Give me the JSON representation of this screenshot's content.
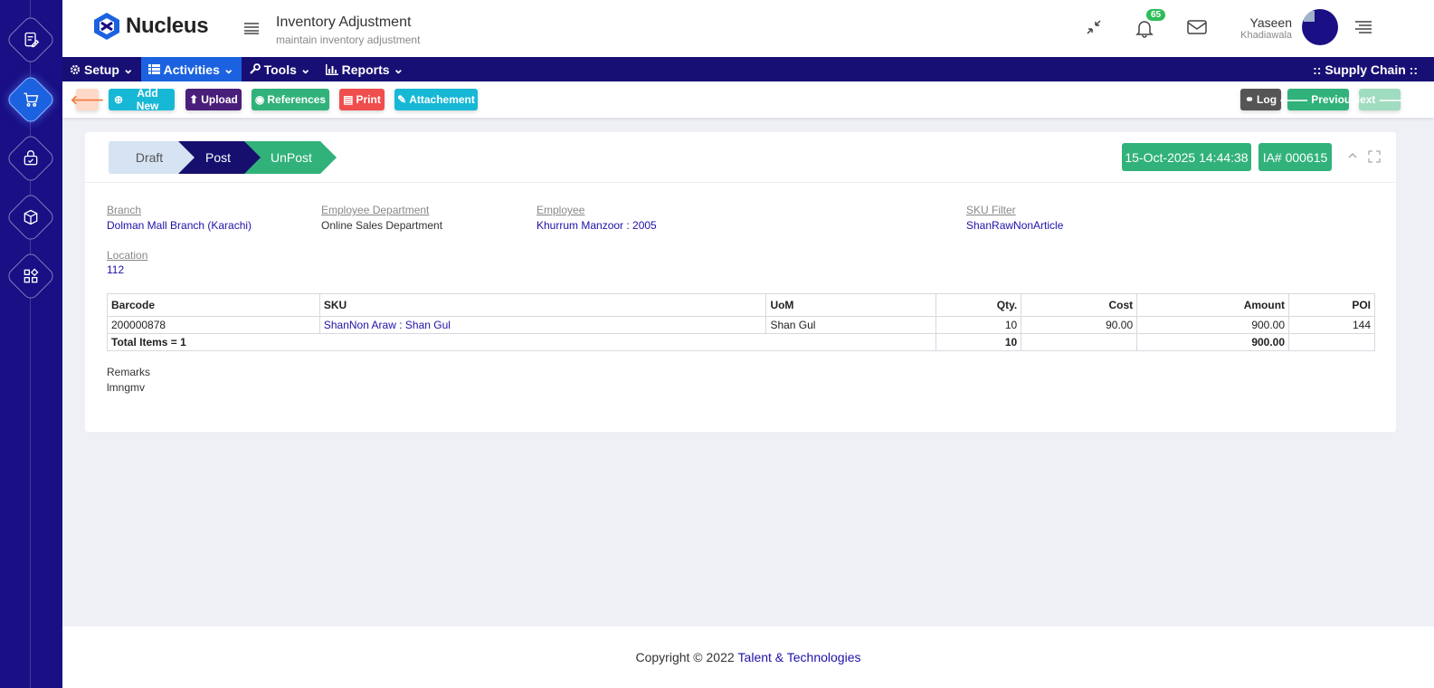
{
  "app": {
    "logo_text": "Nucleus",
    "page_title": "Inventory Adjustment",
    "page_subtitle": "maintain inventory adjustment"
  },
  "header": {
    "notification_count": "65",
    "user_name": "Yaseen",
    "user_surname": "Khadiawala"
  },
  "nav": {
    "items": [
      {
        "label": "Setup"
      },
      {
        "label": "Activities"
      },
      {
        "label": "Tools"
      },
      {
        "label": "Reports"
      }
    ],
    "module": ":: Supply Chain ::"
  },
  "toolbar": {
    "add_new": "Add New",
    "upload": "Upload",
    "references": "References",
    "print": "Print",
    "attachment": "Attachement",
    "log": "Log",
    "previous": "Previous",
    "next": "Next"
  },
  "workflow": {
    "steps": [
      "Draft",
      "Post",
      "UnPost"
    ],
    "datetime": "15-Oct-2025 14:44:38",
    "doc_no": "IA# 000615"
  },
  "form": {
    "branch_label": "Branch",
    "branch_value": "Dolman Mall Branch (Karachi)",
    "dept_label": "Employee Department",
    "dept_value": "Online Sales Department",
    "employee_label": "Employee",
    "employee_value": "Khurrum Manzoor : 2005",
    "sku_filter_label": "SKU Filter",
    "sku_filter_value": "ShanRawNonArticle",
    "location_label": "Location",
    "location_value": "112",
    "remarks_label": "Remarks",
    "remarks_value": "lmngmv"
  },
  "table": {
    "headers": [
      "Barcode",
      "SKU",
      "UoM",
      "Qty.",
      "Cost",
      "Amount",
      "POI"
    ],
    "rows": [
      {
        "barcode": "200000878",
        "sku": "ShanNon Araw : Shan Gul",
        "uom": "Shan Gul",
        "qty": "10",
        "cost": "90.00",
        "amount": "900.00",
        "poi": "144"
      }
    ],
    "total_label": "Total Items = 1",
    "total_qty": "10",
    "total_amount": "900.00"
  },
  "footer": {
    "copyright": "Copyright © 2022",
    "company": "Talent & Technologies"
  },
  "colors": {
    "rail": "#1a0f85",
    "navbar": "#180f75",
    "accent": "#1c62e0",
    "green": "#31b27a",
    "cyan": "#17b8d6",
    "purple": "#4a1f7a",
    "red": "#f04d4d"
  }
}
